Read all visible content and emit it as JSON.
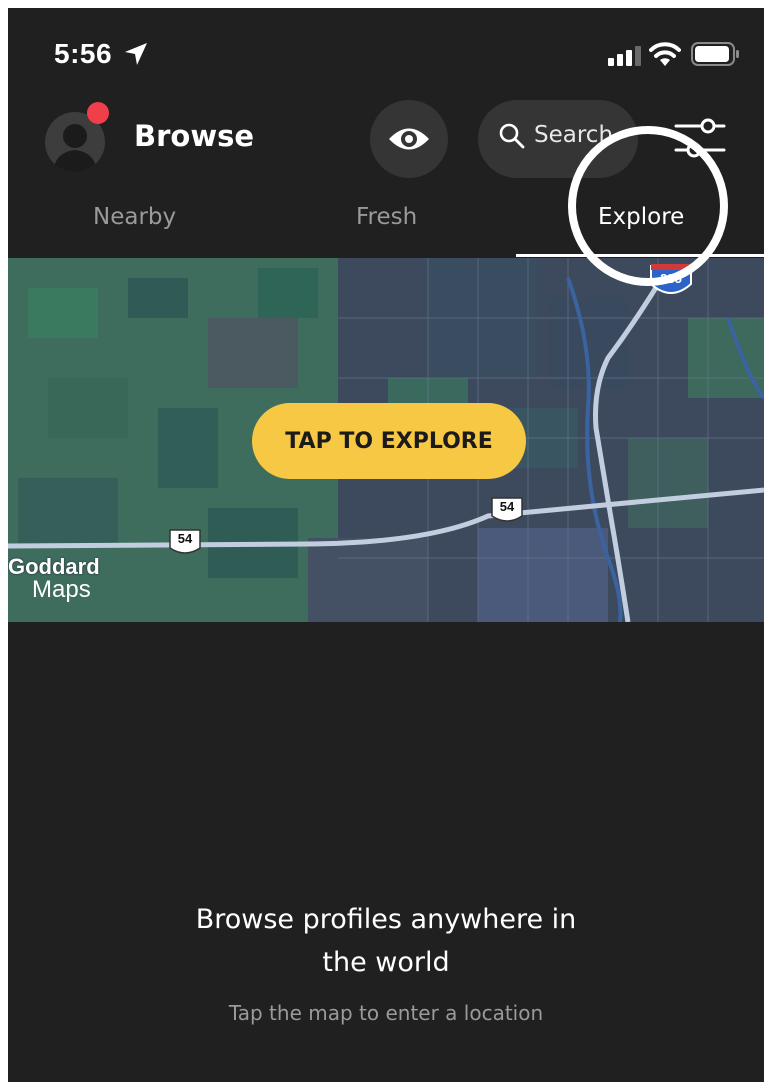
{
  "status_bar": {
    "time": "5:56",
    "icons": [
      "location-arrow-icon",
      "signal-icon",
      "wifi-icon",
      "battery-icon"
    ]
  },
  "header": {
    "title": "Browse",
    "search_label": "Search",
    "icons": [
      "avatar",
      "eye-icon",
      "search-icon",
      "filter-sliders-icon"
    ],
    "notification_color": "#ef3f4a"
  },
  "tabs": [
    {
      "label": "Nearby",
      "active": false
    },
    {
      "label": "Fresh",
      "active": false
    },
    {
      "label": "Explore",
      "active": true
    }
  ],
  "map": {
    "cta_label": "TAP TO EXPLORE",
    "city_label": "Goddard",
    "attribution": "Maps",
    "route_shields": [
      "54",
      "54",
      "235"
    ],
    "cta_color": "#f7c843"
  },
  "empty_state": {
    "title_line1": "Browse profiles anywhere in",
    "title_line2": "the world",
    "subtitle": "Tap the map to enter a location"
  },
  "colors": {
    "background": "#202020",
    "pill": "#353535",
    "inactive_text": "#9a9a9a"
  }
}
